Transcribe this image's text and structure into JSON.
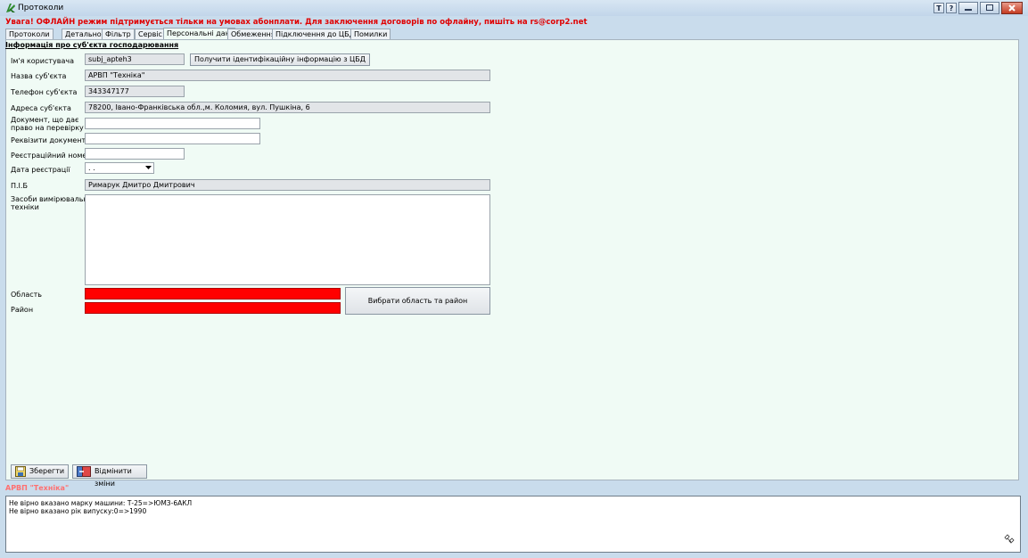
{
  "window": {
    "title": "Протоколи",
    "tb_t": "T",
    "tb_help": "?"
  },
  "warning": "Увага! ОФЛАЙН режим підтримується тільки на умовах абонплати. Для заключення договорів по офлайну, пишіть на rs@corp2.net",
  "tabs": [
    "Протоколи",
    "Детально",
    "Фільтр",
    "Сервіс",
    "Персональні дані",
    "Обмеження",
    "Підключення до ЦБД",
    "Помилки"
  ],
  "section_title": "Інформація про суб'єкта господарювання",
  "form": {
    "username_label": "Ім'я користувача",
    "username_value": "subj_apteh3",
    "get_info_button": "Получити ідентифікаційну інформацію з ЦБД",
    "subject_name_label": "Назва суб'єкта",
    "subject_name_value": "АРВП \"Техніка\"",
    "phone_label": "Телефон суб'єкта",
    "phone_value": "343347177",
    "address_label": "Адреса суб'єкта",
    "address_value": "78200, Івано-Франківська обл.,м. Коломия, вул. Пушкіна, 6",
    "document_label_1": "Документ, що дає",
    "document_label_2": "право на перевірку",
    "document_value": "",
    "requisites_label": "Реквізити документа",
    "requisites_value": "",
    "reg_number_label": "Реєстраційний номер",
    "reg_number_value": "",
    "reg_date_label": "Дата реєстрації",
    "reg_date_value": " .  .",
    "pib_label": "П.І.Б",
    "pib_value": "Римарук Дмитро Дмитрович",
    "instruments_label_1": "Засоби вимірювальної",
    "instruments_label_2": "техніки",
    "instruments_value": "",
    "region_label": "Область",
    "district_label": "Район",
    "choose_region_button": "Вибрати область та район"
  },
  "actions": {
    "save": "Зберегти",
    "cancel": "Відмінити зміни"
  },
  "org_name_status": "АРВП \"Техніка\"",
  "log_lines": [
    "Не вірно вказано марку машини: Т-25=>ЮМЗ-6АКЛ",
    "Не вірно вказано рік випуску:0=>1990"
  ],
  "colors": {
    "error_field": "#ff0000",
    "panel_bg": "#f0fbf5",
    "warning_text": "#e00000"
  }
}
